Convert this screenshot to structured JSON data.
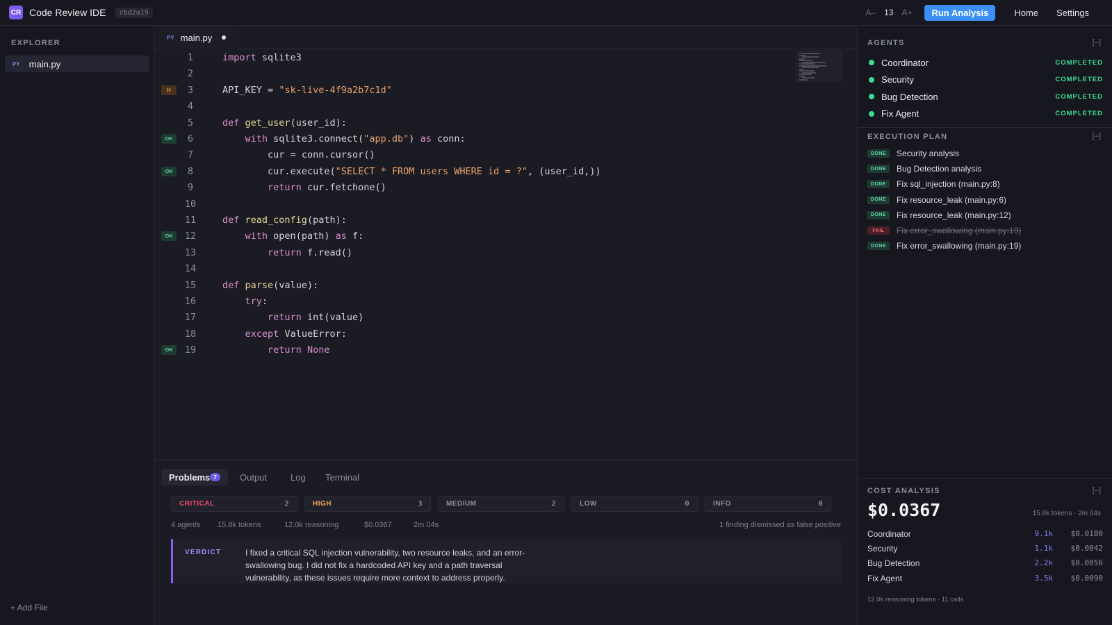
{
  "app": {
    "logo": "CR",
    "title": "Code Review IDE",
    "commit": "cbd2a19"
  },
  "toolbar": {
    "font_decrease": "A–",
    "font_size": "13",
    "font_increase": "A+",
    "run_label": "Run Analysis",
    "home": "Home",
    "settings": "Settings"
  },
  "explorer": {
    "title": "EXPLORER",
    "files": [
      {
        "badge": "PY",
        "name": "main.py"
      }
    ],
    "add_file": "+ Add File"
  },
  "editor": {
    "tab": {
      "badge": "PY",
      "name": "main.py",
      "modified": true
    },
    "lines": [
      {
        "n": 1,
        "code": "import sqlite3",
        "marker": ""
      },
      {
        "n": 2,
        "code": "",
        "marker": ""
      },
      {
        "n": 3,
        "code": "API_KEY = \"sk-live-4f9a2b7c1d\"",
        "marker": "H"
      },
      {
        "n": 4,
        "code": "",
        "marker": ""
      },
      {
        "n": 5,
        "code": "def get_user(user_id):",
        "marker": ""
      },
      {
        "n": 6,
        "code": "    with sqlite3.connect(\"app.db\") as conn:",
        "marker": "OK"
      },
      {
        "n": 7,
        "code": "        cur = conn.cursor()",
        "marker": ""
      },
      {
        "n": 8,
        "code": "        cur.execute(\"SELECT * FROM users WHERE id = ?\", (user_id,))",
        "marker": "OK"
      },
      {
        "n": 9,
        "code": "        return cur.fetchone()",
        "marker": ""
      },
      {
        "n": 10,
        "code": "",
        "marker": ""
      },
      {
        "n": 11,
        "code": "def read_config(path):",
        "marker": ""
      },
      {
        "n": 12,
        "code": "    with open(path) as f:",
        "marker": "OK"
      },
      {
        "n": 13,
        "code": "        return f.read()",
        "marker": ""
      },
      {
        "n": 14,
        "code": "",
        "marker": ""
      },
      {
        "n": 15,
        "code": "def parse(value):",
        "marker": ""
      },
      {
        "n": 16,
        "code": "    try:",
        "marker": ""
      },
      {
        "n": 17,
        "code": "        return int(value)",
        "marker": ""
      },
      {
        "n": 18,
        "code": "    except ValueError:",
        "marker": ""
      },
      {
        "n": 19,
        "code": "        return None",
        "marker": "OK"
      }
    ]
  },
  "bottom_panel": {
    "tabs": [
      {
        "label": "Problems",
        "count": "7",
        "active": true
      },
      {
        "label": "Output"
      },
      {
        "label": "Log"
      },
      {
        "label": "Terminal"
      }
    ],
    "severities": [
      {
        "label": "CRITICAL",
        "count": "2",
        "color": "#f0506a"
      },
      {
        "label": "HIGH",
        "count": "3",
        "color": "#f0a860"
      },
      {
        "label": "MEDIUM",
        "count": "2",
        "color": "#8d8e9c"
      },
      {
        "label": "LOW",
        "count": "0",
        "color": "#8d8e9c"
      },
      {
        "label": "INFO",
        "count": "0",
        "color": "#8d8e9c"
      }
    ],
    "stats": {
      "agents": "4 agents",
      "tokens": "15.8k tokens",
      "reasoning": "12.0k reasoning",
      "cost": "$0.0367",
      "duration": "2m 04s",
      "dismissed": "1 finding dismissed as false positive"
    },
    "verdict": {
      "label": "VERDICT",
      "text": "I fixed a critical SQL injection vulnerability, two resource leaks, and an error-swallowing bug. I did not fix a hardcoded API key and a path traversal vulnerability, as these issues require more context to address properly."
    }
  },
  "agents": {
    "title": "AGENTS",
    "collapse": "[–]",
    "items": [
      {
        "name": "Coordinator",
        "status": "COMPLETED"
      },
      {
        "name": "Security",
        "status": "COMPLETED"
      },
      {
        "name": "Bug Detection",
        "status": "COMPLETED"
      },
      {
        "name": "Fix Agent",
        "status": "COMPLETED"
      }
    ]
  },
  "plan": {
    "title": "EXECUTION PLAN",
    "collapse": "[–]",
    "items": [
      {
        "status": "DONE",
        "label": "Security analysis"
      },
      {
        "status": "DONE",
        "label": "Bug Detection analysis"
      },
      {
        "status": "DONE",
        "label": "Fix sql_injection (main.py:8)"
      },
      {
        "status": "DONE",
        "label": "Fix resource_leak (main.py:6)"
      },
      {
        "status": "DONE",
        "label": "Fix resource_leak (main.py:12)"
      },
      {
        "status": "FAIL",
        "label": "Fix error_swallowing (main.py:19)"
      },
      {
        "status": "DONE",
        "label": "Fix error_swallowing (main.py:19)"
      }
    ]
  },
  "cost": {
    "title": "COST ANALYSIS",
    "collapse": "[–]",
    "total": "$0.0367",
    "meta": "15.8k tokens · 2m 04s",
    "rows": [
      {
        "name": "Coordinator",
        "tokens": "9.1k",
        "cost": "$0.0180"
      },
      {
        "name": "Security",
        "tokens": "1.1k",
        "cost": "$0.0042"
      },
      {
        "name": "Bug Detection",
        "tokens": "2.2k",
        "cost": "$0.0056"
      },
      {
        "name": "Fix Agent",
        "tokens": "3.5k",
        "cost": "$0.0090"
      }
    ],
    "footer": "12.0k reasoning tokens · 11 calls"
  }
}
